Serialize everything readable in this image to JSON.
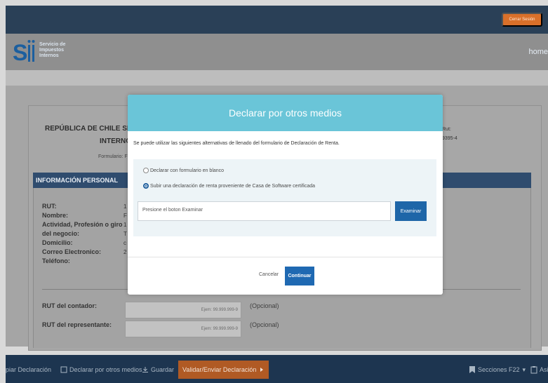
{
  "header": {
    "logout_label": "Cerrar Sesión"
  },
  "logo": {
    "line1": "Servicio de",
    "line2": "Impuestos",
    "line3": "Internos"
  },
  "nav": {
    "home_label": "home"
  },
  "form": {
    "rep_title_line1": "REPÚBLICA DE CHILE SERV",
    "rep_title_line2": "INTERNO",
    "form_label": "Formulario: F2",
    "rut_right_label": "Rut:",
    "rut_right_value": "9395-4",
    "info_header": "INFORMACIÓN PERSONAL",
    "info_labels": [
      "RUT:",
      "Nombre:",
      "Actividad, Profesión o giro",
      "del negocio:",
      "Domicilio:",
      "Correo Electronico:",
      "Teléfono:"
    ],
    "info_values": [
      "1",
      "F",
      "1",
      "",
      "T",
      "c",
      "2"
    ],
    "contador_label": "RUT del contador:",
    "representante_label": "RUT del representante:",
    "field_placeholder": "Ejem: 99.999.999-9",
    "opcional": "(Opcional)"
  },
  "footer": {
    "copiar": "piar Declaración",
    "declarar_otros": "Declarar por otros medios",
    "guardar": "Guardar",
    "validar": "Validar/Enviar Declaración",
    "secciones": "Secciones F22",
    "asis": "Asi"
  },
  "modal": {
    "title": "Declarar por otros medios",
    "intro": "Se puede utilizar las siguientes alternativas de llenado del formulario de Declaración de Renta.",
    "option1": "Declarar con formulario en blanco",
    "option2": "Subir una declaración de renta proveniente de Casa de Software certificada",
    "file_placeholder": "Presione el boton Examinar",
    "examinar": "Examinar",
    "cancelar": "Cancelar",
    "continuar": "Continuar"
  },
  "colors": {
    "modal_header": "#6ac5d8",
    "primary_button": "#1f69b2",
    "accent_orange": "#b05a24",
    "top_bar": "#2a4057"
  }
}
